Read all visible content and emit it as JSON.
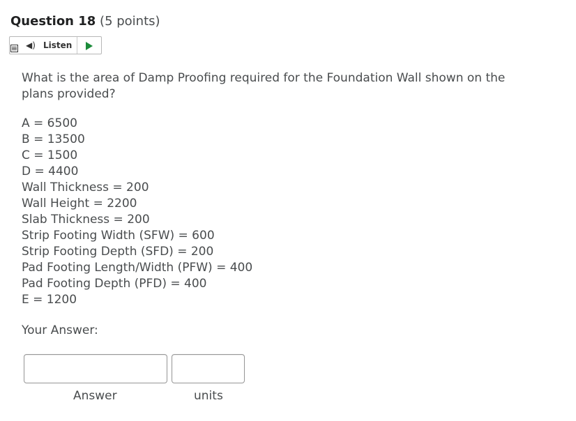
{
  "question": {
    "title_number": "Question 18",
    "title_points": "(5 points)",
    "text": "What is the area of Damp Proofing required for the Foundation Wall shown on the plans provided?"
  },
  "listen": {
    "label": "Listen",
    "menu_icon": "menu-icon",
    "speaker_icon": "speaker-icon",
    "play_icon": "play-icon",
    "play_color": "#1b8b3a"
  },
  "params": [
    "A = 6500",
    "B = 13500",
    "C = 1500",
    "D = 4400",
    "Wall Thickness = 200",
    "Wall Height = 2200",
    "Slab Thickness = 200",
    "Strip Footing Width (SFW) = 600",
    "Strip Footing Depth (SFD) = 200",
    "Pad Footing Length/Width (PFW) = 400",
    "Pad Footing Depth (PFD) = 400",
    "E = 1200"
  ],
  "answer": {
    "heading": "Your Answer:",
    "answer_value": "",
    "units_value": "",
    "answer_label": "Answer",
    "units_label": "units"
  }
}
